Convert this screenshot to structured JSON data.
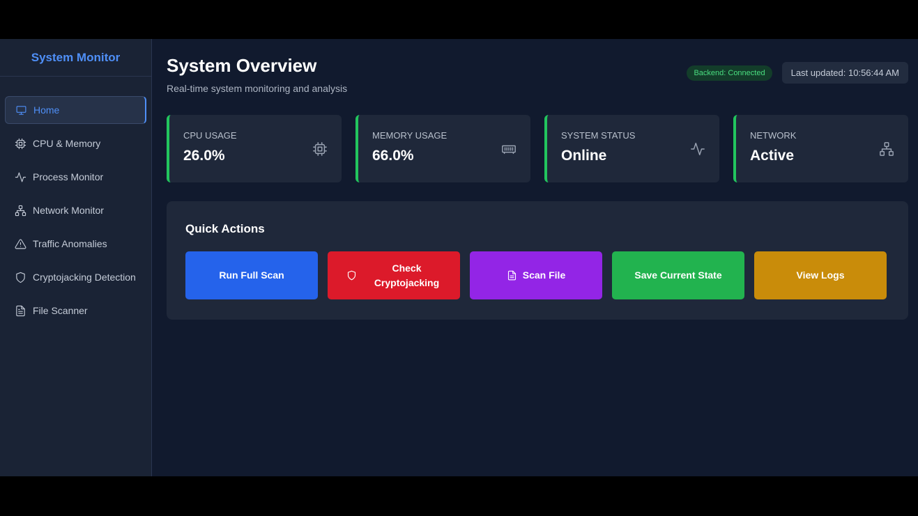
{
  "sidebar": {
    "brand": "System Monitor",
    "items": [
      {
        "label": "Home",
        "icon": "monitor-icon",
        "active": true
      },
      {
        "label": "CPU & Memory",
        "icon": "cpu-icon"
      },
      {
        "label": "Process Monitor",
        "icon": "activity-icon"
      },
      {
        "label": "Network Monitor",
        "icon": "network-icon"
      },
      {
        "label": "Traffic Anomalies",
        "icon": "alert-triangle-icon"
      },
      {
        "label": "Cryptojacking Detection",
        "icon": "shield-icon"
      },
      {
        "label": "File Scanner",
        "icon": "file-icon"
      }
    ]
  },
  "header": {
    "title": "System Overview",
    "subtitle": "Real-time system monitoring and analysis",
    "backend_status": "Backend: Connected",
    "last_updated": "Last updated: 10:56:44 AM"
  },
  "stats": [
    {
      "label": "CPU USAGE",
      "value": "26.0%",
      "icon": "cpu-icon"
    },
    {
      "label": "MEMORY USAGE",
      "value": "66.0%",
      "icon": "memory-icon"
    },
    {
      "label": "SYSTEM STATUS",
      "value": "Online",
      "icon": "activity-icon"
    },
    {
      "label": "NETWORK",
      "value": "Active",
      "icon": "network-icon"
    }
  ],
  "quick_actions": {
    "title": "Quick Actions",
    "buttons": [
      {
        "label": "Run Full Scan",
        "color": "#2563eb"
      },
      {
        "label": "Check Cryptojacking",
        "color": "#dc1a2a",
        "icon": "shield-icon"
      },
      {
        "label": "Scan File",
        "color": "#9325e6",
        "icon": "file-icon"
      },
      {
        "label": "Save Current State",
        "color": "#22b34f"
      },
      {
        "label": "View Logs",
        "color": "#c98c0a"
      }
    ]
  },
  "colors": {
    "accent": "#4f8ff7",
    "success": "#22c55e"
  }
}
